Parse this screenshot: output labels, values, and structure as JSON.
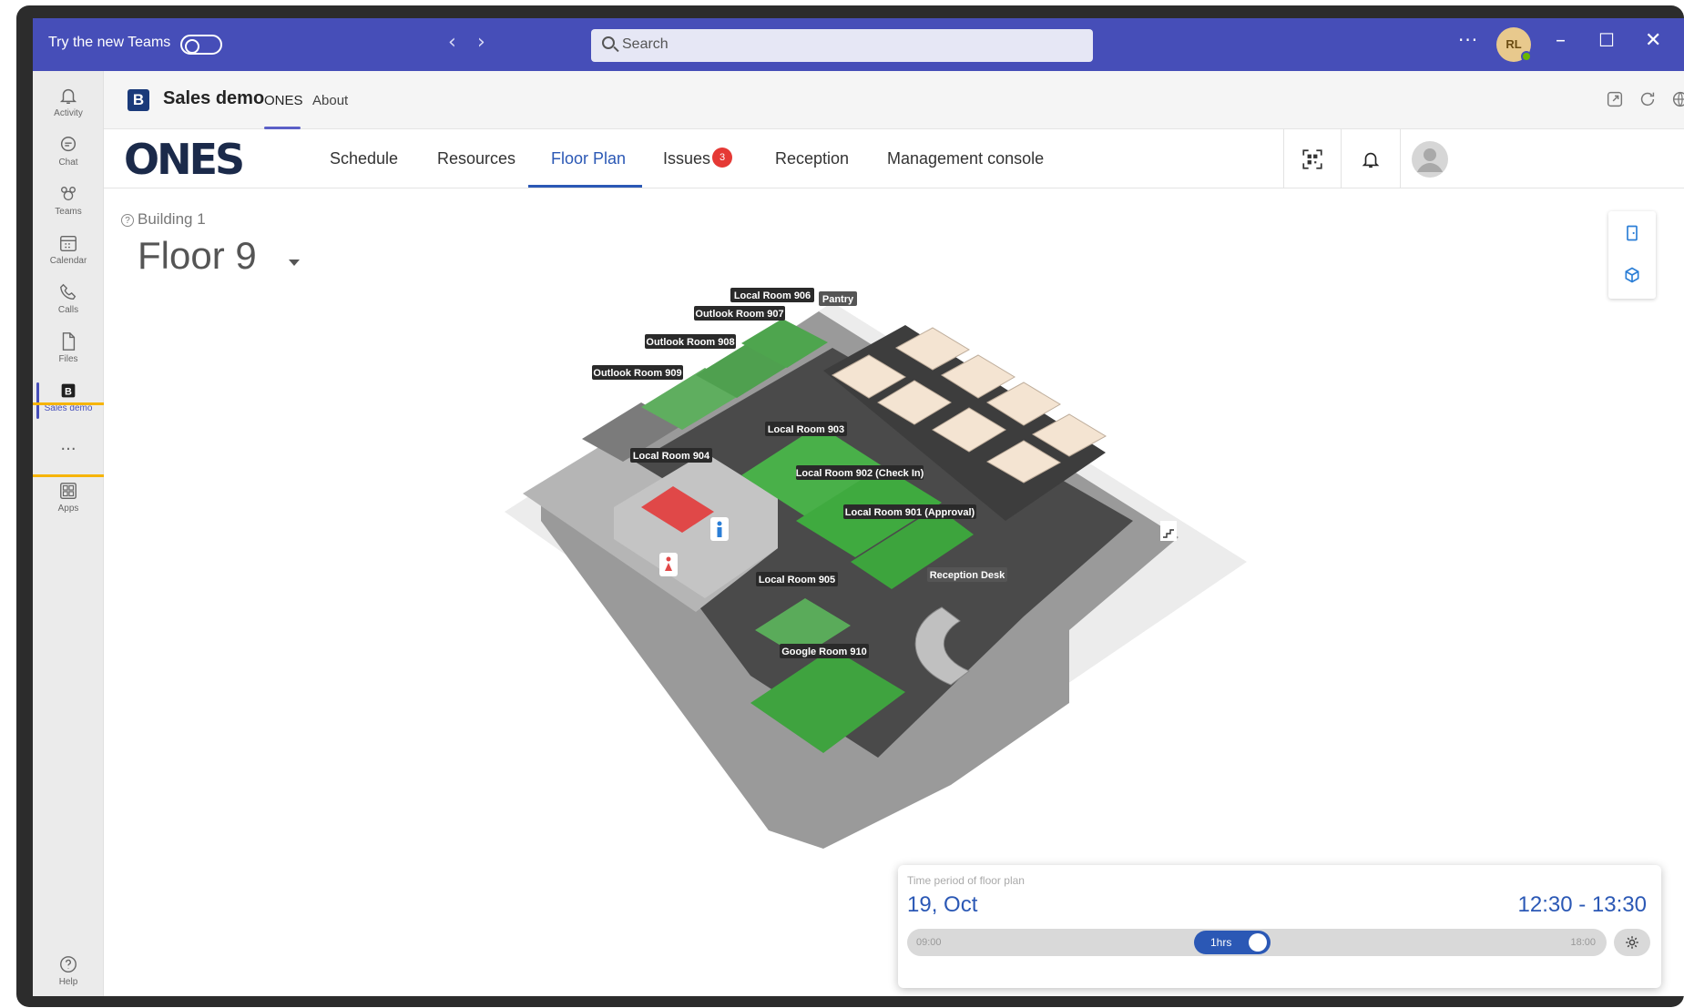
{
  "titlebar": {
    "try_label": "Try the new Teams",
    "search_placeholder": "Search",
    "more": "···",
    "avatar_initials": "RL"
  },
  "rail": {
    "items": [
      {
        "label": "Activity",
        "icon": "bell-icon"
      },
      {
        "label": "Chat",
        "icon": "chat-icon"
      },
      {
        "label": "Teams",
        "icon": "teams-icon"
      },
      {
        "label": "Calendar",
        "icon": "calendar-icon"
      },
      {
        "label": "Calls",
        "icon": "phone-icon"
      },
      {
        "label": "Files",
        "icon": "file-icon"
      },
      {
        "label": "Sales demo",
        "icon": "app-b-icon"
      },
      {
        "label": "",
        "icon": "more-icon"
      },
      {
        "label": "Apps",
        "icon": "apps-icon"
      },
      {
        "label": "Help",
        "icon": "help-icon"
      }
    ],
    "more": "···"
  },
  "app_header": {
    "logo_letter": "B",
    "app_name": "Sales demo",
    "tabs": [
      "ONES",
      "About"
    ]
  },
  "ones_nav": {
    "logo": "ONES",
    "tabs": [
      "Schedule",
      "Resources",
      "Floor Plan",
      "Issues",
      "Reception",
      "Management console"
    ],
    "issues_count": "3"
  },
  "content": {
    "building": "Building 1",
    "floor": "Floor 9"
  },
  "rooms": {
    "r906": "Local Room 906",
    "pantry": "Pantry",
    "r907": "Outlook Room 907",
    "r908": "Outlook Room 908",
    "r909": "Outlook Room 909",
    "r903": "Local Room 903",
    "r904": "Local Room 904",
    "r902": "Local Room 902 (Check In)",
    "r901": "Local Room 901 (Approval)",
    "reception": "Reception Desk",
    "r905": "Local Room 905",
    "r910": "Google Room 910"
  },
  "time_panel": {
    "caption": "Time period of floor plan",
    "date": "19, Oct",
    "range": "12:30  -  13:30",
    "start": "09:00",
    "end": "18:00",
    "duration": "1hrs",
    "selected_start_fraction": 0.46
  },
  "colors": {
    "teams_purple": "#464eb8",
    "ones_blue": "#2b58b5",
    "available_green": "#3faa3f",
    "occupied_red": "#e04848"
  }
}
